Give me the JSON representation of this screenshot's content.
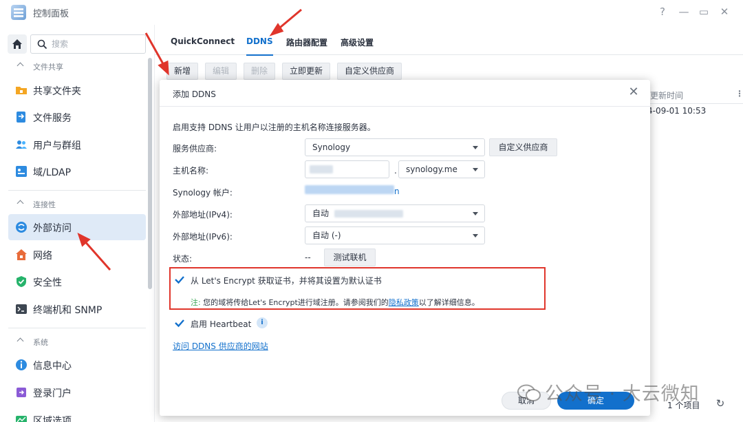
{
  "window": {
    "title": "控制面板",
    "controls": [
      "?",
      "—",
      "▭",
      "✕"
    ]
  },
  "sidebar": {
    "search_placeholder": "搜索",
    "sections": [
      {
        "title": "文件共享",
        "items": [
          {
            "label": "共享文件夹",
            "icon": "shared-folder-icon"
          },
          {
            "label": "文件服务",
            "icon": "file-services-icon"
          },
          {
            "label": "用户与群组",
            "icon": "users-groups-icon"
          },
          {
            "label": "域/LDAP",
            "icon": "domain-ldap-icon"
          }
        ]
      },
      {
        "title": "连接性",
        "items": [
          {
            "label": "外部访问",
            "icon": "external-access-icon",
            "active": true
          },
          {
            "label": "网络",
            "icon": "network-icon"
          },
          {
            "label": "安全性",
            "icon": "security-icon"
          },
          {
            "label": "终端机和 SNMP",
            "icon": "terminal-snmp-icon"
          }
        ]
      },
      {
        "title": "系统",
        "items": [
          {
            "label": "信息中心",
            "icon": "info-center-icon"
          },
          {
            "label": "登录门户",
            "icon": "login-portal-icon"
          },
          {
            "label": "区域选项",
            "icon": "regional-options-icon"
          }
        ]
      }
    ]
  },
  "main": {
    "tabs": [
      "QuickConnect",
      "DDNS",
      "路由器配置",
      "高级设置"
    ],
    "active_tab": "DDNS",
    "toolbar": {
      "add": "新增",
      "edit": "编辑",
      "delete": "删除",
      "update_now": "立即更新",
      "custom_provider": "自定义供应商"
    },
    "grid": {
      "header": "更新时间",
      "cell": "4-09-01 10:53"
    },
    "footer": {
      "count": "1 个项目"
    }
  },
  "dialog": {
    "title": "添加 DDNS",
    "description": "启用支持 DDNS 让用户以注册的主机名称连接服务器。",
    "provider_label": "服务供应商:",
    "provider_value": "Synology",
    "custom_provider_button": "自定义供应商",
    "hostname_label": "主机名称:",
    "hostname_domain": "synology.me",
    "account_label": "Synology 帐户:",
    "account_suffix": "n",
    "ipv4_label": "外部地址(IPv4):",
    "ipv4_value": "自动",
    "ipv6_label": "外部地址(IPv6):",
    "ipv6_value": "自动 (-)",
    "status_label": "状态:",
    "status_value": "--",
    "test_button": "测试联机",
    "letsencrypt_label": "从 Let's Encrypt 获取证书，并将其设置为默认证书",
    "note_prefix": "注:",
    "note_text": " 您的域将传给Let's Encrypt进行域注册。请参阅我们的",
    "note_link": "隐私政策",
    "note_suffix": "以了解详细信息。",
    "heartbeat_label": "启用 Heartbeat",
    "ddns_site_link": "访问 DDNS 供应商的网站",
    "cancel": "取消",
    "ok": "确定"
  },
  "watermark": "公众号 · 大云微知",
  "colors": {
    "accent": "#1270cc",
    "highlight_box": "#e0352b",
    "annotation_arrow": "#e0352b"
  }
}
